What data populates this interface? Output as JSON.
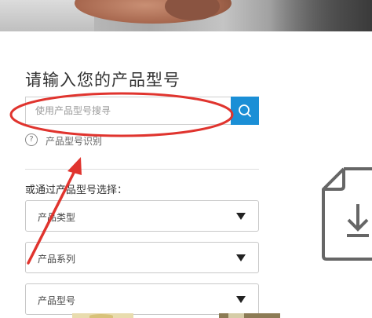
{
  "page": {
    "title": "请输入您的产品型号"
  },
  "search": {
    "placeholder": "使用产品型号搜寻",
    "button_icon": "search-icon"
  },
  "recognition": {
    "label": "产品型号识别",
    "icon": "help-icon",
    "icon_glyph": "?"
  },
  "choose": {
    "label": "或通过产品型号选择："
  },
  "selects": [
    {
      "label": "产品类型"
    },
    {
      "label": "产品系列"
    },
    {
      "label": "产品型号"
    }
  ],
  "colors": {
    "accent": "#1b8fd6",
    "annotation": "#e0342e"
  },
  "side_icon": "document-download-icon"
}
